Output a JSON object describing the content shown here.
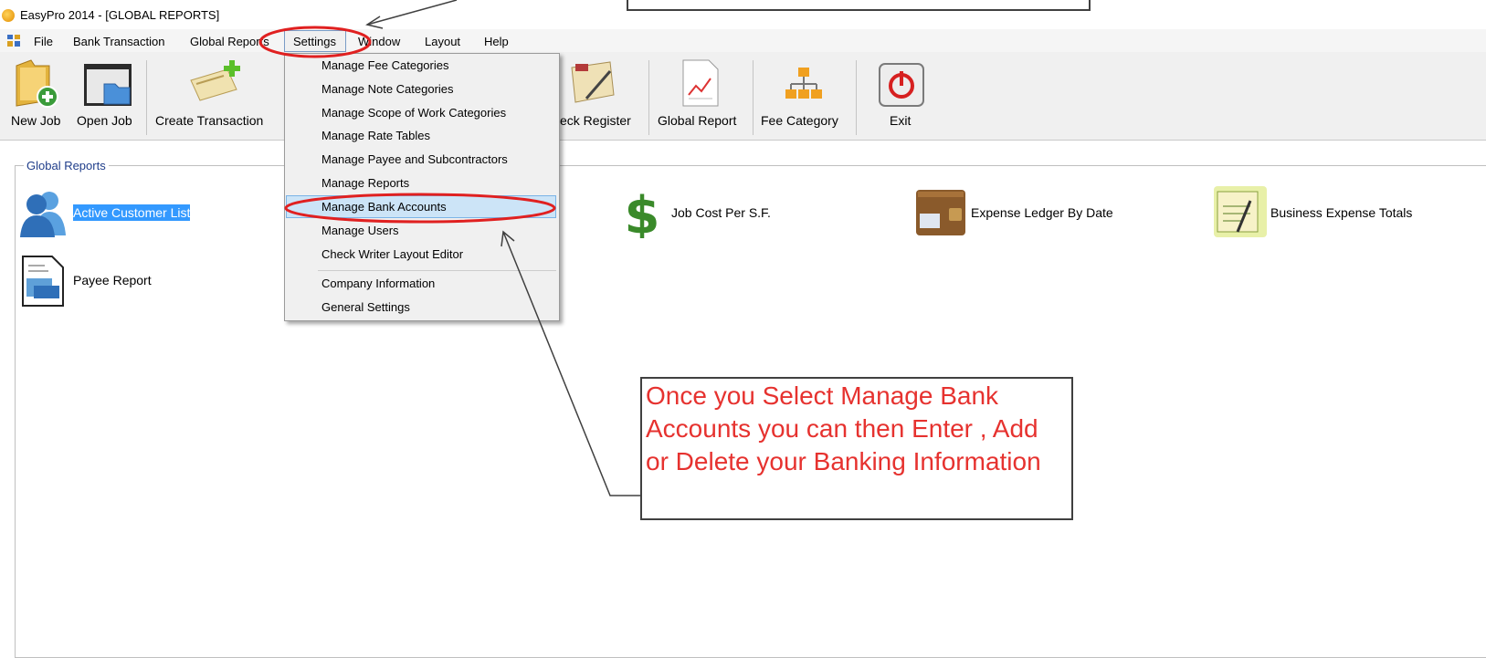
{
  "window": {
    "title": "EasyPro 2014 - [GLOBAL REPORTS]"
  },
  "menubar": {
    "items": [
      "File",
      "Bank Transaction",
      "Global Reports",
      "Settings",
      "Window",
      "Layout",
      "Help"
    ]
  },
  "toolbar": {
    "buttons": [
      {
        "label": "New Job",
        "icon": "new-job-folder-icon"
      },
      {
        "label": "Open Job",
        "icon": "open-job-window-icon"
      },
      {
        "label": "Create Transaction",
        "icon": "create-transaction-check-icon"
      },
      {
        "label": "eck Register",
        "icon": "check-register-icon"
      },
      {
        "label": "Global Report",
        "icon": "global-report-chart-icon"
      },
      {
        "label": "Fee Category",
        "icon": "fee-category-hierarchy-icon"
      },
      {
        "label": "Exit",
        "icon": "power-icon"
      }
    ]
  },
  "group": {
    "title": "Global Reports",
    "reports": [
      {
        "label": "Active Customer List",
        "icon": "customers-icon",
        "selected": true
      },
      {
        "label": "Job Cost Per S.F.",
        "icon": "dollar-icon"
      },
      {
        "label": "Expense Ledger By Date",
        "icon": "wallet-icon"
      },
      {
        "label": "Business Expense Totals",
        "icon": "receipt-icon"
      },
      {
        "label": "Payee Report",
        "icon": "contract-icon"
      }
    ]
  },
  "settings_menu": {
    "items": [
      "Manage Fee Categories",
      "Manage Note Categories",
      "Manage Scope of Work Categories",
      "Manage Rate Tables",
      "Manage Payee and Subcontractors",
      "Manage Reports",
      "Manage Bank Accounts",
      "Manage Users",
      "Check Writer Layout Editor",
      "Company Information",
      "General Settings"
    ],
    "highlighted": "Manage Bank Accounts"
  },
  "callout": {
    "text": "Once you Select Manage Bank Accounts you can then Enter , Add or Delete your Banking Information"
  },
  "colors": {
    "callout_text": "#e6322f",
    "annotation_ellipse": "#e02020",
    "selection": "#3399ff"
  }
}
